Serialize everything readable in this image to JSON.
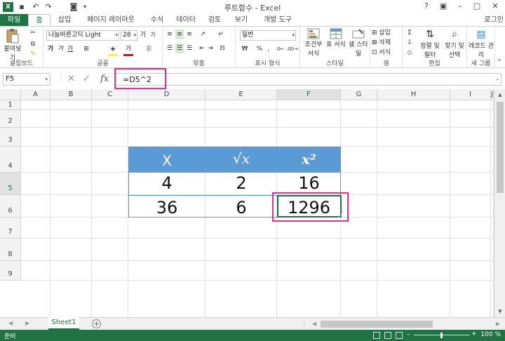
{
  "window": {
    "title": "루트함수 - Excel",
    "app_icon": "X",
    "login": "로그인"
  },
  "tabs": [
    "파일",
    "홈",
    "삽입",
    "페이지 레이아웃",
    "수식",
    "데이터",
    "검토",
    "보기",
    "개발 도구"
  ],
  "ribbon": {
    "clipboard": {
      "paste": "붙여넣기",
      "label": "클립보드"
    },
    "font": {
      "name": "나눔바른고딕 Light",
      "size": "28",
      "bold": "가",
      "italic": "가",
      "underline": "가",
      "label": "글꼴"
    },
    "alignment": {
      "label": "맞춤"
    },
    "number": {
      "format": "일반",
      "percent": "%",
      "comma": ",",
      "label": "표시 형식"
    },
    "styles": {
      "conditional": "조건부 서식",
      "table": "표 서식",
      "cell": "셀 스타일",
      "label": "스타일"
    },
    "cells": {
      "insert": "삽입",
      "delete": "삭제",
      "format": "서식",
      "label": "셀"
    },
    "editing": {
      "sort": "정렬 및 필터",
      "find": "찾기 및 선택",
      "label": "편집"
    },
    "new_group": {
      "record": "레코드 관리",
      "label": "새 그룹"
    }
  },
  "formula_bar": {
    "name_box": "F5",
    "fx": "fx",
    "formula": "=D5^2"
  },
  "columns": [
    "A",
    "B",
    "C",
    "D",
    "E",
    "F",
    "G",
    "H",
    "I",
    "J"
  ],
  "selected_column": "F",
  "rows": [
    "1",
    "2",
    "3",
    "4",
    "5",
    "6",
    "7",
    "8",
    "9"
  ],
  "selected_row": "5",
  "table": {
    "headers": [
      "X",
      "√x",
      "x²"
    ],
    "rows": [
      [
        "4",
        "2",
        "16"
      ],
      [
        "36",
        "6",
        "1296"
      ]
    ]
  },
  "sheets": [
    "Sheet1"
  ],
  "status": {
    "mode": "준비",
    "zoom": "100 %"
  },
  "colors": {
    "excel_green": "#217346",
    "table_header": "#5b9bd5",
    "highlight": "#e0338a"
  }
}
